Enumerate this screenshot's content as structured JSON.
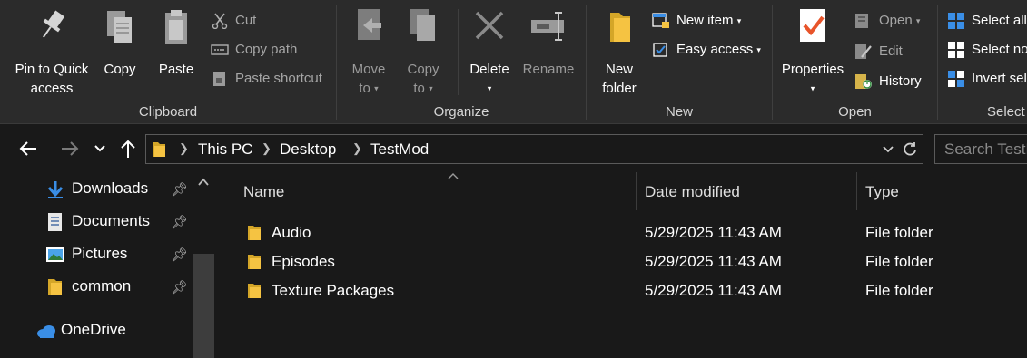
{
  "ribbon": {
    "clipboard": {
      "label": "Clipboard",
      "pin_label_1": "Pin to Quick",
      "pin_label_2": "access",
      "copy": "Copy",
      "paste": "Paste",
      "cut": "Cut",
      "copy_path": "Copy path",
      "paste_shortcut": "Paste shortcut"
    },
    "organize": {
      "label": "Organize",
      "move_to_1": "Move",
      "move_to_2": "to",
      "copy_to_1": "Copy",
      "copy_to_2": "to",
      "delete": "Delete",
      "rename": "Rename"
    },
    "new": {
      "label": "New",
      "new_folder_1": "New",
      "new_folder_2": "folder",
      "new_item": "New item",
      "easy_access": "Easy access"
    },
    "open": {
      "label": "Open",
      "properties": "Properties",
      "open": "Open",
      "edit": "Edit",
      "history": "History"
    },
    "select": {
      "label": "Select",
      "select_all": "Select all",
      "select_none": "Select none",
      "invert_selection": "Invert selection"
    }
  },
  "address": {
    "crumbs": [
      "This PC",
      "Desktop",
      "TestMod"
    ],
    "search_placeholder": "Search TestMod"
  },
  "navpane": {
    "items": [
      {
        "label": "Downloads",
        "icon": "download-arrow-icon",
        "pinned": true
      },
      {
        "label": "Documents",
        "icon": "document-icon",
        "pinned": true
      },
      {
        "label": "Pictures",
        "icon": "pictures-icon",
        "pinned": true
      },
      {
        "label": "common",
        "icon": "folder-icon",
        "pinned": true
      },
      {
        "label": "OneDrive",
        "icon": "cloud-icon",
        "pinned": false
      }
    ]
  },
  "content": {
    "columns": {
      "name": "Name",
      "date_modified": "Date modified",
      "type": "Type"
    },
    "rows": [
      {
        "name": "Audio",
        "date": "5/29/2025 11:43 AM",
        "type": "File folder"
      },
      {
        "name": "Episodes",
        "date": "5/29/2025 11:43 AM",
        "type": "File folder"
      },
      {
        "name": "Texture Packages",
        "date": "5/29/2025 11:43 AM",
        "type": "File folder"
      }
    ]
  },
  "colors": {
    "background": "#191919",
    "ribbon": "#2b2b2b",
    "folder": "#f5c342",
    "accent_blue": "#3a8ee6",
    "properties_check": "#e8542a"
  }
}
